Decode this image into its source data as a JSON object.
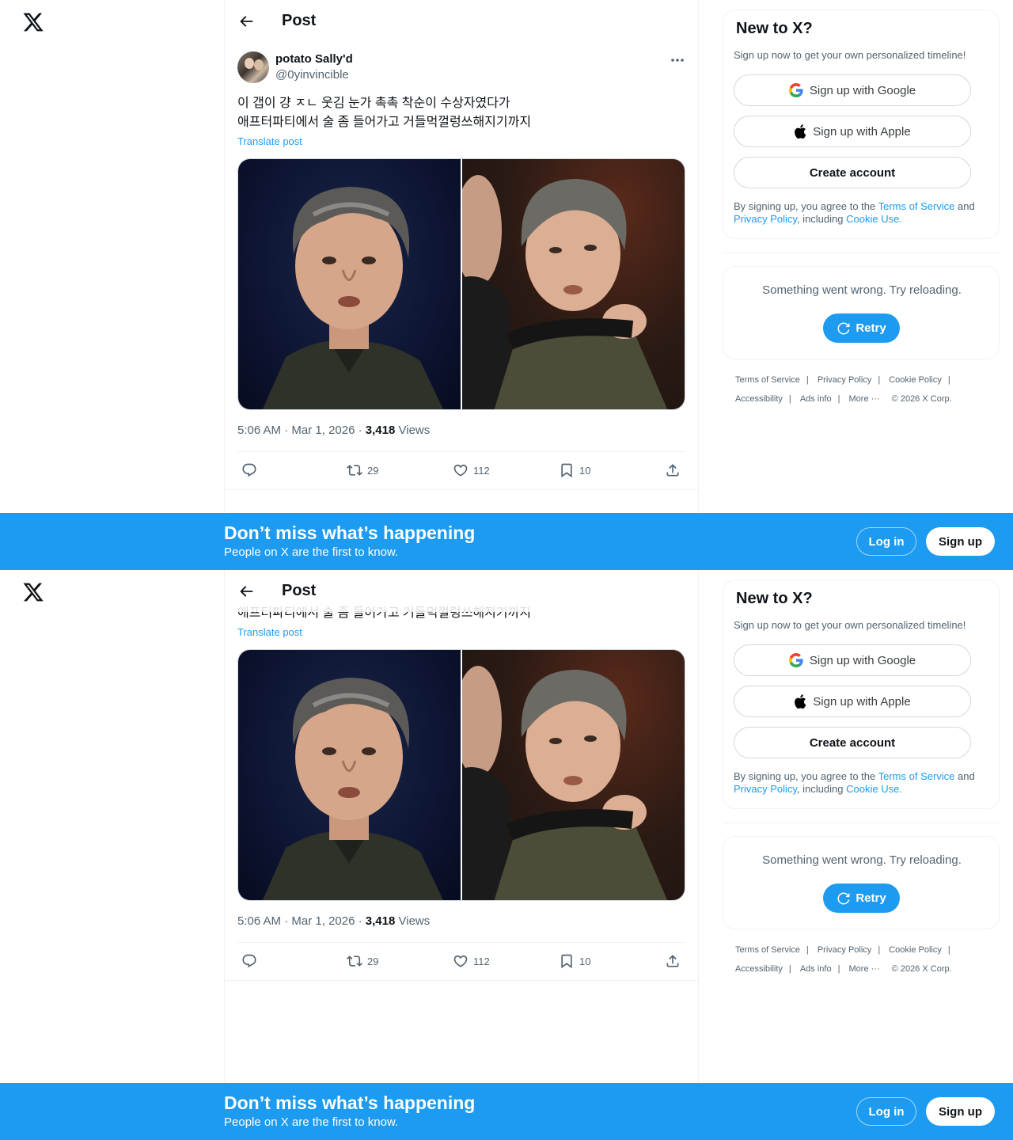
{
  "header": {
    "title": "Post"
  },
  "post": {
    "display_name": "potato Sally'd",
    "handle": "@0yinvincible",
    "text_line1": "이 갭이 걍 ㅈㄴ 웃김 눈가 촉촉 착순이 수상자였다가",
    "text_line2": "애프터파티에서 술 좀 들어가고 거들먹껄렁쓰해지기까지",
    "translate_label": "Translate post",
    "time": "5:06 AM",
    "date": "Mar 1, 2026",
    "views_count": "3,418",
    "views_label": "Views",
    "retweets": "29",
    "likes": "112",
    "bookmarks": "10"
  },
  "signup_card": {
    "title": "New to X?",
    "subtitle": "Sign up now to get your own personalized timeline!",
    "google_label": "Sign up with Google",
    "apple_label": "Sign up with Apple",
    "create_label": "Create account",
    "terms_prefix": "By signing up, you agree to the ",
    "terms_link": "Terms of Service",
    "terms_and": " and",
    "privacy_link": "Privacy Policy",
    "including": ", including ",
    "cookie_link": "Cookie Use."
  },
  "error_card": {
    "message": "Something went wrong. Try reloading.",
    "retry_label": "Retry"
  },
  "footer": {
    "terms": "Terms of Service",
    "privacy": "Privacy Policy",
    "cookie": "Cookie Policy",
    "accessibility": "Accessibility",
    "ads": "Ads info",
    "more": "More ···",
    "copyright": "© 2026 X Corp."
  },
  "banner": {
    "title": "Don’t miss what’s happening",
    "subtitle": "People on X are the first to know.",
    "login_label": "Log in",
    "signup_label": "Sign up"
  },
  "colors": {
    "accent": "#1d9bf0",
    "text": "#0f1419",
    "secondary": "#536471",
    "border": "#eff3f4"
  },
  "icons": [
    "x-logo-icon",
    "back-arrow-icon",
    "more-icon",
    "reply-icon",
    "retweet-icon",
    "like-icon",
    "bookmark-icon",
    "share-icon",
    "google-icon",
    "apple-icon",
    "refresh-icon"
  ]
}
